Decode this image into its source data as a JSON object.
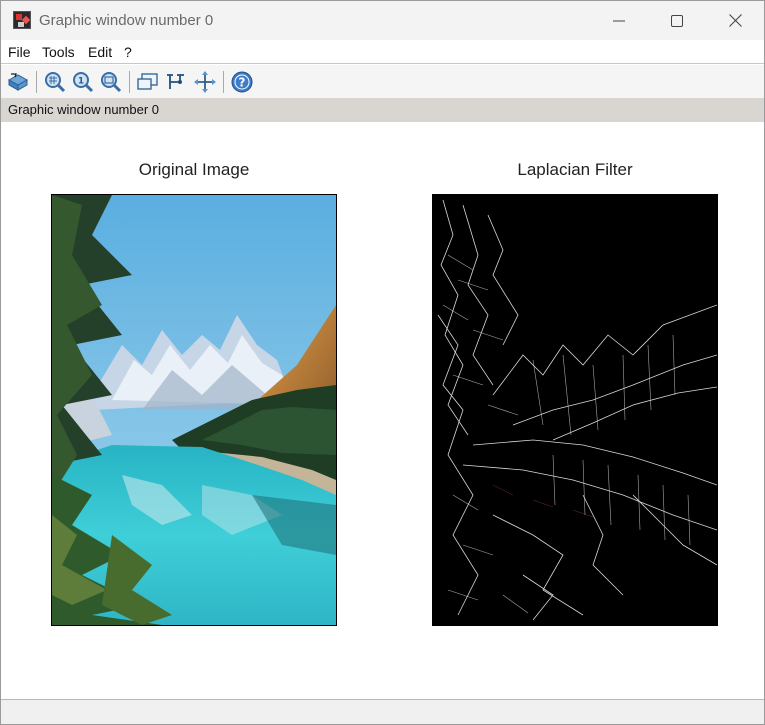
{
  "window": {
    "title": "Graphic window number 0"
  },
  "menu": {
    "items": [
      "File",
      "Tools",
      "Edit",
      "?"
    ]
  },
  "toolbar": {
    "buttons": [
      "rotate-icon",
      "zoom-in-icon",
      "zoom-reset-icon",
      "zoom-area-icon",
      "datatip-icon",
      "curve-edit-icon",
      "pan-icon",
      "help-icon"
    ]
  },
  "info": {
    "label": "Graphic window number 0"
  },
  "plots": {
    "left_title": "Original Image",
    "right_title": "Laplacian Filter"
  },
  "colors": {
    "titlebar": "#f3f3f3",
    "infobar": "#d9d6d1",
    "lake": "#3cc7cf",
    "sky": "#7bc3e8",
    "edge_bg": "#000000"
  }
}
